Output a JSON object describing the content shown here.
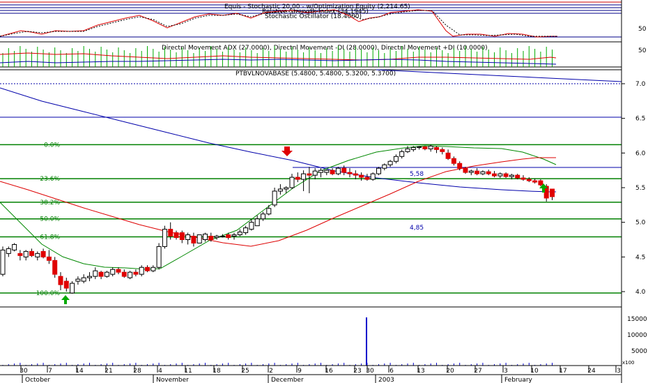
{
  "colors": {
    "fib": "#008000",
    "ma_long": "#0000aa",
    "ma_mid": "#008800",
    "ma_fast": "#dd0000",
    "up_candle": "#ffffff",
    "down_candle": "#e00000",
    "arrow_down": "#e00000",
    "arrow_up": "#00aa00",
    "panel_line": "#000000"
  },
  "panels": {
    "stochastic": {
      "title_equis": "Equis - Stochastic 20,00 - w/Optimization Equity (2,214.65)",
      "title_rsi": "Relative Strength Index (34.1945)",
      "title_stoch": "Stochastic Oscillator (18.4000)",
      "level_label": "50"
    },
    "dmi": {
      "title": "Directnl Movement ADX (27.0000), Directnl Movement -DI (28.0000), Directnl Movement +DI (10.0000)",
      "level_label": "50"
    },
    "price": {
      "title": "PTBVLNOVABASE (5.4800, 5.4800, 5.3200, 5.3700)",
      "label_558": "5,58",
      "label_485": "4,85"
    },
    "volume": {
      "label_x100": "x100"
    }
  },
  "chart_data": {
    "type": "candlestick",
    "title": "PTBVLNOVABASE (5.4800, 5.4800, 5.3200, 5.3700)",
    "last_ohlc": {
      "open": 5.48,
      "high": 5.48,
      "low": 5.32,
      "close": 5.37
    },
    "ylim": [
      3.55,
      7.1
    ],
    "y_ticks": [
      "7.0",
      "6.5",
      "6.0",
      "5.5",
      "5.0",
      "4.5",
      "4.0"
    ],
    "fibonacci": [
      {
        "label": "0.0%",
        "value": 6.12
      },
      {
        "label": "23.6%",
        "value": 5.63
      },
      {
        "label": "38.2%",
        "value": 5.29
      },
      {
        "label": "50.0%",
        "value": 5.05
      },
      {
        "label": "61.8%",
        "value": 4.79
      },
      {
        "label": "100.0%",
        "value": 3.98
      }
    ],
    "x_ticks": [
      "30",
      "7",
      "14",
      "21",
      "28",
      "4",
      "11",
      "18",
      "25",
      "2",
      "9",
      "16",
      "23",
      "30",
      "6",
      "13",
      "20",
      "27",
      "3",
      "10",
      "17",
      "24",
      "3"
    ],
    "months": [
      "October",
      "November",
      "December",
      "2003",
      "February"
    ],
    "volume_ticks": [
      "15000",
      "10000",
      "5000"
    ],
    "candles": [
      {
        "o": 4.25,
        "h": 4.65,
        "l": 4.22,
        "c": 4.6
      },
      {
        "o": 4.55,
        "h": 4.65,
        "l": 4.5,
        "c": 4.62
      },
      {
        "o": 4.6,
        "h": 4.7,
        "l": 4.58,
        "c": 4.68
      },
      {
        "o": 4.55,
        "h": 4.6,
        "l": 4.45,
        "c": 4.52
      },
      {
        "o": 4.5,
        "h": 4.6,
        "l": 4.45,
        "c": 4.58
      },
      {
        "o": 4.58,
        "h": 4.62,
        "l": 4.5,
        "c": 4.52
      },
      {
        "o": 4.5,
        "h": 4.58,
        "l": 4.45,
        "c": 4.55
      },
      {
        "o": 4.58,
        "h": 4.62,
        "l": 4.48,
        "c": 4.5
      },
      {
        "o": 4.5,
        "h": 4.6,
        "l": 4.4,
        "c": 4.45
      },
      {
        "o": 4.45,
        "h": 4.5,
        "l": 4.2,
        "c": 4.25
      },
      {
        "o": 4.22,
        "h": 4.28,
        "l": 4.02,
        "c": 4.1
      },
      {
        "o": 4.15,
        "h": 4.2,
        "l": 4.0,
        "c": 4.05
      },
      {
        "o": 3.98,
        "h": 4.15,
        "l": 3.97,
        "c": 4.12
      },
      {
        "o": 4.15,
        "h": 4.22,
        "l": 4.1,
        "c": 4.18
      },
      {
        "o": 4.15,
        "h": 4.25,
        "l": 4.12,
        "c": 4.2
      },
      {
        "o": 4.2,
        "h": 4.28,
        "l": 4.15,
        "c": 4.22
      },
      {
        "o": 4.22,
        "h": 4.35,
        "l": 4.18,
        "c": 4.3
      },
      {
        "o": 4.28,
        "h": 4.3,
        "l": 4.18,
        "c": 4.22
      },
      {
        "o": 4.22,
        "h": 4.3,
        "l": 4.2,
        "c": 4.28
      },
      {
        "o": 4.25,
        "h": 4.35,
        "l": 4.22,
        "c": 4.32
      },
      {
        "o": 4.32,
        "h": 4.35,
        "l": 4.25,
        "c": 4.28
      },
      {
        "o": 4.28,
        "h": 4.32,
        "l": 4.2,
        "c": 4.22
      },
      {
        "o": 4.2,
        "h": 4.3,
        "l": 4.18,
        "c": 4.28
      },
      {
        "o": 4.28,
        "h": 4.32,
        "l": 4.22,
        "c": 4.25
      },
      {
        "o": 4.25,
        "h": 4.38,
        "l": 4.22,
        "c": 4.35
      },
      {
        "o": 4.35,
        "h": 4.38,
        "l": 4.28,
        "c": 4.3
      },
      {
        "o": 4.3,
        "h": 4.38,
        "l": 4.28,
        "c": 4.35
      },
      {
        "o": 4.35,
        "h": 4.7,
        "l": 4.32,
        "c": 4.65
      },
      {
        "o": 4.65,
        "h": 4.95,
        "l": 4.62,
        "c": 4.9
      },
      {
        "o": 4.9,
        "h": 5.0,
        "l": 4.75,
        "c": 4.8
      },
      {
        "o": 4.85,
        "h": 4.88,
        "l": 4.75,
        "c": 4.78
      },
      {
        "o": 4.85,
        "h": 4.88,
        "l": 4.7,
        "c": 4.75
      },
      {
        "o": 4.75,
        "h": 4.85,
        "l": 4.68,
        "c": 4.82
      },
      {
        "o": 4.8,
        "h": 4.85,
        "l": 4.65,
        "c": 4.7
      },
      {
        "o": 4.7,
        "h": 4.82,
        "l": 4.7,
        "c": 4.82
      },
      {
        "o": 4.75,
        "h": 4.85,
        "l": 4.72,
        "c": 4.83
      },
      {
        "o": 4.8,
        "h": 4.85,
        "l": 4.72,
        "c": 4.75
      },
      {
        "o": 4.78,
        "h": 4.82,
        "l": 4.75,
        "c": 4.8
      },
      {
        "o": 4.8,
        "h": 4.83,
        "l": 4.78,
        "c": 4.8
      },
      {
        "o": 4.82,
        "h": 4.85,
        "l": 4.75,
        "c": 4.78
      },
      {
        "o": 4.8,
        "h": 4.85,
        "l": 4.75,
        "c": 4.82
      },
      {
        "o": 4.82,
        "h": 4.9,
        "l": 4.8,
        "c": 4.86
      },
      {
        "o": 4.85,
        "h": 4.95,
        "l": 4.82,
        "c": 4.92
      },
      {
        "o": 4.9,
        "h": 5.05,
        "l": 4.88,
        "c": 5.0
      },
      {
        "o": 4.95,
        "h": 5.1,
        "l": 4.95,
        "c": 5.05
      },
      {
        "o": 5.05,
        "h": 5.15,
        "l": 5.02,
        "c": 5.12
      },
      {
        "o": 5.12,
        "h": 5.25,
        "l": 5.1,
        "c": 5.2
      },
      {
        "o": 5.25,
        "h": 5.5,
        "l": 5.22,
        "c": 5.45
      },
      {
        "o": 5.45,
        "h": 5.55,
        "l": 5.4,
        "c": 5.48
      },
      {
        "o": 5.48,
        "h": 5.52,
        "l": 5.42,
        "c": 5.5
      },
      {
        "o": 5.5,
        "h": 5.7,
        "l": 5.48,
        "c": 5.65
      },
      {
        "o": 5.65,
        "h": 5.72,
        "l": 5.58,
        "c": 5.62
      },
      {
        "o": 5.62,
        "h": 5.75,
        "l": 5.45,
        "c": 5.7
      },
      {
        "o": 5.7,
        "h": 5.8,
        "l": 5.42,
        "c": 5.68
      },
      {
        "o": 5.68,
        "h": 5.78,
        "l": 5.62,
        "c": 5.74
      },
      {
        "o": 5.72,
        "h": 5.78,
        "l": 5.65,
        "c": 5.75
      },
      {
        "o": 5.72,
        "h": 5.76,
        "l": 5.68,
        "c": 5.75
      },
      {
        "o": 5.75,
        "h": 5.78,
        "l": 5.68,
        "c": 5.7
      },
      {
        "o": 5.7,
        "h": 5.8,
        "l": 5.68,
        "c": 5.78
      },
      {
        "o": 5.78,
        "h": 5.82,
        "l": 5.68,
        "c": 5.72
      },
      {
        "o": 5.72,
        "h": 5.78,
        "l": 5.65,
        "c": 5.7
      },
      {
        "o": 5.7,
        "h": 5.75,
        "l": 5.62,
        "c": 5.68
      },
      {
        "o": 5.68,
        "h": 5.72,
        "l": 5.6,
        "c": 5.65
      },
      {
        "o": 5.65,
        "h": 5.7,
        "l": 5.6,
        "c": 5.62
      },
      {
        "o": 5.62,
        "h": 5.72,
        "l": 5.6,
        "c": 5.7
      },
      {
        "o": 5.7,
        "h": 5.8,
        "l": 5.68,
        "c": 5.78
      },
      {
        "o": 5.78,
        "h": 5.85,
        "l": 5.75,
        "c": 5.83
      },
      {
        "o": 5.83,
        "h": 5.9,
        "l": 5.8,
        "c": 5.88
      },
      {
        "o": 5.88,
        "h": 5.98,
        "l": 5.85,
        "c": 5.95
      },
      {
        "o": 5.95,
        "h": 6.05,
        "l": 5.92,
        "c": 6.02
      },
      {
        "o": 6.02,
        "h": 6.1,
        "l": 6.0,
        "c": 6.06
      },
      {
        "o": 6.05,
        "h": 6.1,
        "l": 6.02,
        "c": 6.08
      },
      {
        "o": 6.08,
        "h": 6.1,
        "l": 6.05,
        "c": 6.09
      },
      {
        "o": 6.09,
        "h": 6.1,
        "l": 6.04,
        "c": 6.06
      },
      {
        "o": 6.06,
        "h": 6.12,
        "l": 6.02,
        "c": 6.1
      },
      {
        "o": 6.08,
        "h": 6.1,
        "l": 6.0,
        "c": 6.05
      },
      {
        "o": 6.05,
        "h": 6.08,
        "l": 5.98,
        "c": 6.02
      },
      {
        "o": 6.0,
        "h": 6.05,
        "l": 5.9,
        "c": 5.92
      },
      {
        "o": 5.92,
        "h": 5.95,
        "l": 5.82,
        "c": 5.85
      },
      {
        "o": 5.85,
        "h": 5.88,
        "l": 5.75,
        "c": 5.78
      },
      {
        "o": 5.78,
        "h": 5.8,
        "l": 5.7,
        "c": 5.72
      },
      {
        "o": 5.72,
        "h": 5.76,
        "l": 5.68,
        "c": 5.74
      },
      {
        "o": 5.74,
        "h": 5.78,
        "l": 5.68,
        "c": 5.7
      },
      {
        "o": 5.7,
        "h": 5.75,
        "l": 5.68,
        "c": 5.73
      },
      {
        "o": 5.73,
        "h": 5.76,
        "l": 5.68,
        "c": 5.7
      },
      {
        "o": 5.7,
        "h": 5.74,
        "l": 5.65,
        "c": 5.67
      },
      {
        "o": 5.67,
        "h": 5.72,
        "l": 5.64,
        "c": 5.7
      },
      {
        "o": 5.7,
        "h": 5.72,
        "l": 5.64,
        "c": 5.66
      },
      {
        "o": 5.66,
        "h": 5.7,
        "l": 5.62,
        "c": 5.68
      },
      {
        "o": 5.68,
        "h": 5.7,
        "l": 5.62,
        "c": 5.64
      },
      {
        "o": 5.64,
        "h": 5.68,
        "l": 5.6,
        "c": 5.62
      },
      {
        "o": 5.62,
        "h": 5.65,
        "l": 5.58,
        "c": 5.6
      },
      {
        "o": 5.6,
        "h": 5.63,
        "l": 5.56,
        "c": 5.58
      },
      {
        "o": 5.6,
        "h": 5.62,
        "l": 5.52,
        "c": 5.54
      },
      {
        "o": 5.52,
        "h": 5.55,
        "l": 5.3,
        "c": 5.35
      },
      {
        "o": 5.48,
        "h": 5.48,
        "l": 5.32,
        "c": 5.37
      }
    ]
  }
}
